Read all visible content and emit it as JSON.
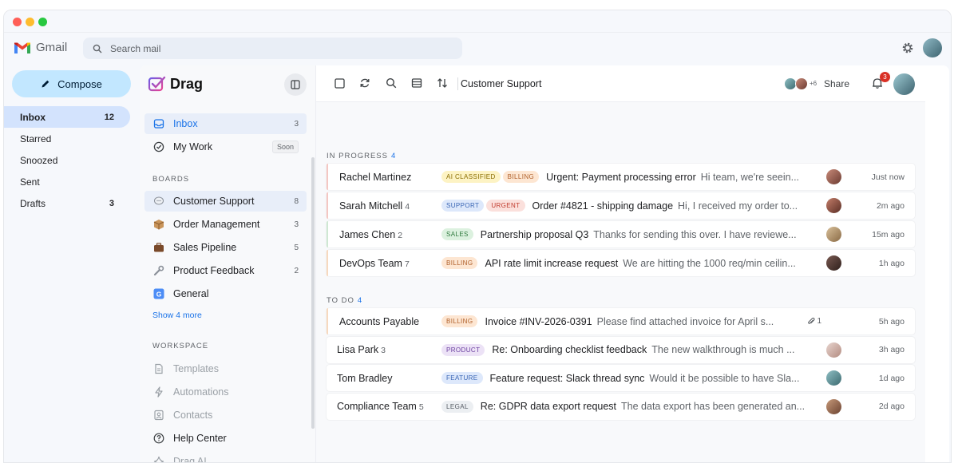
{
  "gmail": {
    "brand": "Gmail",
    "search_placeholder": "Search mail",
    "compose_label": "Compose",
    "nav": [
      {
        "label": "Inbox",
        "count": "12",
        "active": true
      },
      {
        "label": "Starred",
        "count": ""
      },
      {
        "label": "Snoozed",
        "count": ""
      },
      {
        "label": "Sent",
        "count": ""
      },
      {
        "label": "Drafts",
        "count": "3"
      }
    ]
  },
  "drag": {
    "brand": "Drag",
    "primary": [
      {
        "label": "Inbox",
        "count": "3",
        "icon": "inbox-icon",
        "active": true
      },
      {
        "label": "My Work",
        "badge": "Soon",
        "icon": "check-circle-icon"
      }
    ],
    "boards_title": "BOARDS",
    "boards": [
      {
        "label": "Customer Support",
        "count": "8",
        "icon": "speech-bubble-icon",
        "active": true
      },
      {
        "label": "Order Management",
        "count": "3",
        "icon": "package-icon"
      },
      {
        "label": "Sales Pipeline",
        "count": "5",
        "icon": "briefcase-icon"
      },
      {
        "label": "Product Feedback",
        "count": "2",
        "icon": "wrench-icon"
      },
      {
        "label": "General",
        "count": "",
        "icon": "g-letter-icon"
      }
    ],
    "show_more": "Show 4 more",
    "workspace_title": "WORKSPACE",
    "workspace": [
      {
        "label": "Templates",
        "icon": "document-icon",
        "muted": true
      },
      {
        "label": "Automations",
        "icon": "bolt-icon",
        "muted": true
      },
      {
        "label": "Contacts",
        "icon": "contact-icon",
        "muted": true
      },
      {
        "label": "Help Center",
        "icon": "help-icon",
        "muted": false
      },
      {
        "label": "Drag AI",
        "icon": "sparkle-icon",
        "muted": true
      }
    ]
  },
  "toolbar": {
    "title": "Customer Support",
    "share_extra": "+6",
    "share_label": "Share",
    "notifications": "3"
  },
  "groups": [
    {
      "title": "IN PROGRESS",
      "count": "4",
      "rows": [
        {
          "sender": "Rachel Martinez",
          "n": "",
          "tags": [
            {
              "t": "AI CLASSIFIED",
              "k": "ai"
            },
            {
              "t": "BILLING",
              "k": "billing"
            }
          ],
          "subject": "Urgent: Payment processing error",
          "preview": "Hi team, we're seein...",
          "attach": "",
          "time": "Just now",
          "bar": "#f4c7c3",
          "avatar": [
            "#c98b7a",
            "#6b3b31"
          ]
        },
        {
          "sender": "Sarah Mitchell",
          "n": "4",
          "tags": [
            {
              "t": "SUPPORT",
              "k": "support"
            },
            {
              "t": "URGENT",
              "k": "urgent"
            }
          ],
          "subject": "Order #4821 - shipping damage",
          "preview": "Hi, I received my order to...",
          "attach": "",
          "time": "2m ago",
          "bar": "#f4c7c3",
          "avatar": [
            "#c47e6a",
            "#5a2e25"
          ]
        },
        {
          "sender": "James Chen",
          "n": "2",
          "tags": [
            {
              "t": "SALES",
              "k": "sales"
            }
          ],
          "subject": "Partnership proposal Q3",
          "preview": "Thanks for sending this over. I have reviewe...",
          "attach": "",
          "time": "15m ago",
          "bar": "#cfe8d3",
          "avatar": [
            "#d8c09a",
            "#8a6a45"
          ]
        },
        {
          "sender": "DevOps Team",
          "n": "7",
          "tags": [
            {
              "t": "BILLING",
              "k": "billing"
            }
          ],
          "subject": "API rate limit increase request",
          "preview": "We are hitting the 1000 req/min ceilin...",
          "attach": "",
          "time": "1h ago",
          "bar": "#f7d9bf",
          "avatar": [
            "#7a5a52",
            "#2e1f1b"
          ]
        }
      ]
    },
    {
      "title": "TO DO",
      "count": "4",
      "rows": [
        {
          "sender": "Accounts Payable",
          "n": "",
          "tags": [
            {
              "t": "BILLING",
              "k": "billing"
            }
          ],
          "subject": "Invoice #INV-2026-0391",
          "preview": "Please find attached invoice for April s...",
          "attach": "1",
          "time": "5h ago",
          "bar": "#f7d9bf",
          "avatar": null
        },
        {
          "sender": "Lisa Park",
          "n": "3",
          "tags": [
            {
              "t": "PRODUCT",
              "k": "product"
            }
          ],
          "subject": "Re: Onboarding checklist feedback",
          "preview": "The new walkthrough is much ...",
          "attach": "",
          "time": "3h ago",
          "bar": "",
          "avatar": [
            "#e8d6d0",
            "#b38b80"
          ]
        },
        {
          "sender": "Tom Bradley",
          "n": "",
          "tags": [
            {
              "t": "FEATURE",
              "k": "feature"
            }
          ],
          "subject": "Feature request: Slack thread sync",
          "preview": "Would it be possible to have Sla...",
          "attach": "",
          "time": "1d ago",
          "bar": "",
          "avatar": [
            "#8fbfc4",
            "#3c6a70"
          ]
        },
        {
          "sender": "Compliance Team",
          "n": "5",
          "tags": [
            {
              "t": "LEGAL",
              "k": "legal"
            }
          ],
          "subject": "Re: GDPR data export request",
          "preview": "The data export has been generated an...",
          "attach": "",
          "time": "2d ago",
          "bar": "",
          "avatar": [
            "#c79a7a",
            "#6b4230"
          ]
        }
      ]
    }
  ],
  "colors": {
    "accent": "#1a73e8",
    "compose_bg": "#c2e7ff",
    "nav_active": "#d3e3fd",
    "badge_red": "#d93025"
  }
}
